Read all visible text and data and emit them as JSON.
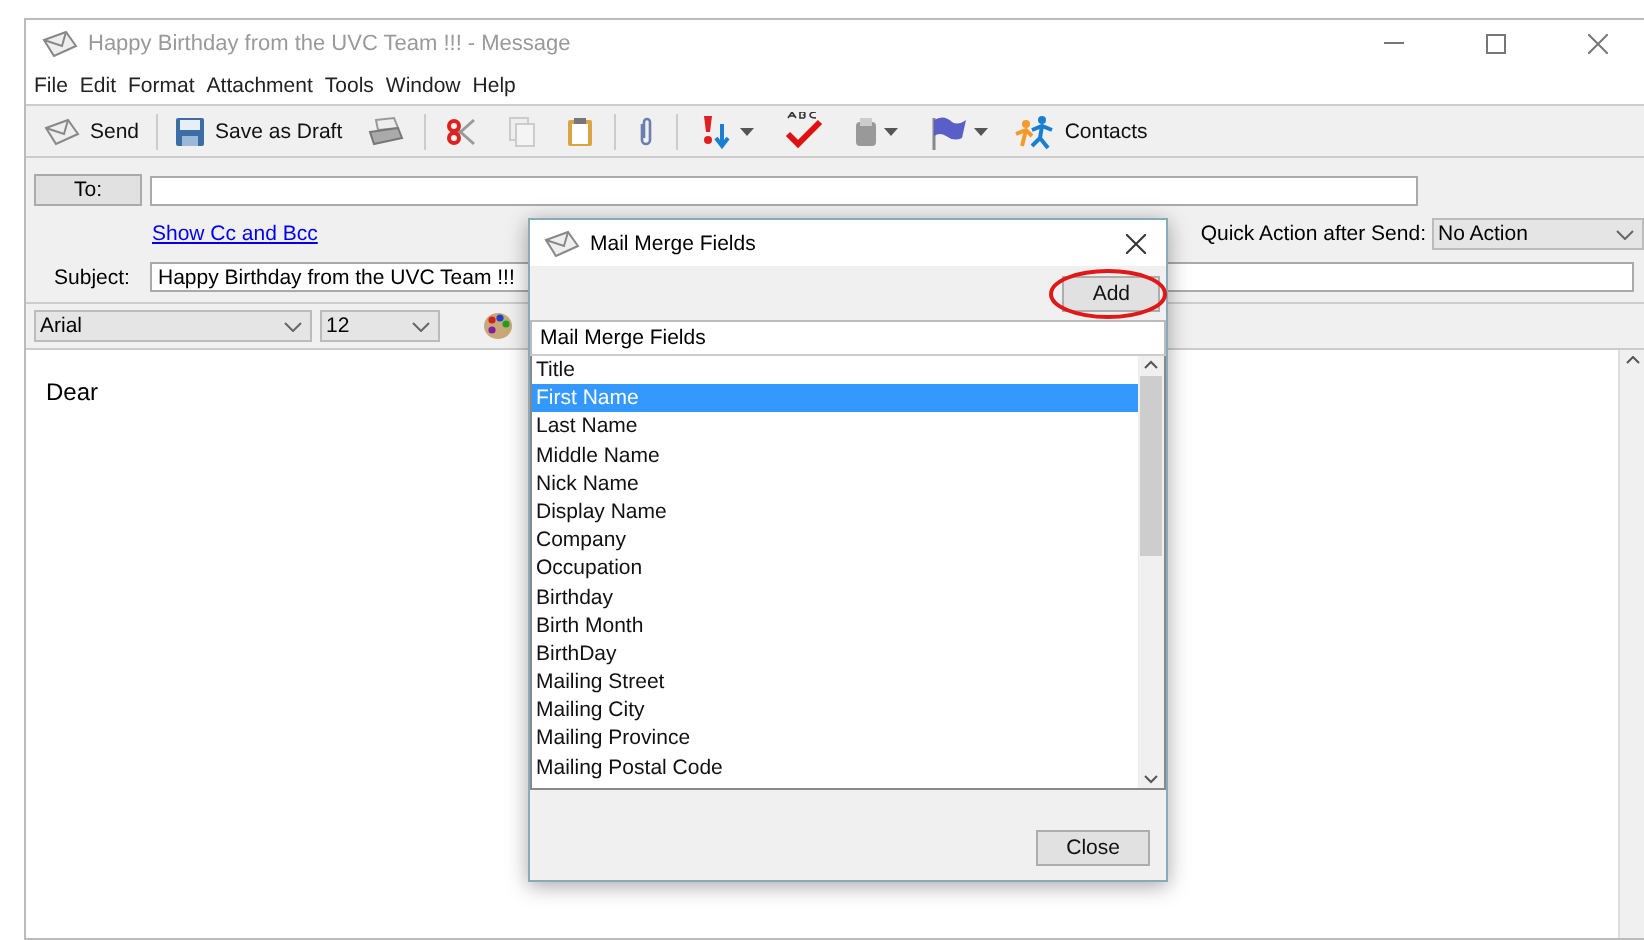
{
  "window": {
    "title": "Happy Birthday from the UVC Team !!! - Message"
  },
  "menu": [
    "File",
    "Edit",
    "Format",
    "Attachment",
    "Tools",
    "Window",
    "Help"
  ],
  "toolbar": {
    "send": "Send",
    "save_draft": "Save as Draft",
    "contacts": "Contacts"
  },
  "header": {
    "to_button": "To:",
    "show_cc_link": "Show Cc and Bcc",
    "quick_action_label": "Quick Action after Send:",
    "quick_action_value": "No Action",
    "subject_label": "Subject:",
    "subject_value": "Happy Birthday from the UVC Team !!!"
  },
  "format": {
    "font": "Arial",
    "size": "12"
  },
  "body": {
    "text": "Dear"
  },
  "dialog": {
    "title": "Mail Merge Fields",
    "add_button": "Add",
    "list_header": "Mail Merge Fields",
    "close_button": "Close",
    "items": [
      {
        "label": "Title",
        "selected": false
      },
      {
        "label": "First Name",
        "selected": true
      },
      {
        "label": "Last Name",
        "selected": false
      },
      {
        "label": "Middle Name",
        "selected": false
      },
      {
        "label": "Nick Name",
        "selected": false
      },
      {
        "label": "Display Name",
        "selected": false
      },
      {
        "label": "Company",
        "selected": false
      },
      {
        "label": "Occupation",
        "selected": false
      },
      {
        "label": "Birthday",
        "selected": false
      },
      {
        "label": "Birth Month",
        "selected": false
      },
      {
        "label": "BirthDay",
        "selected": false
      },
      {
        "label": "Mailing Street",
        "selected": false
      },
      {
        "label": "Mailing City",
        "selected": false
      },
      {
        "label": "Mailing Province",
        "selected": false
      },
      {
        "label": "Mailing Postal Code",
        "selected": false
      }
    ]
  }
}
